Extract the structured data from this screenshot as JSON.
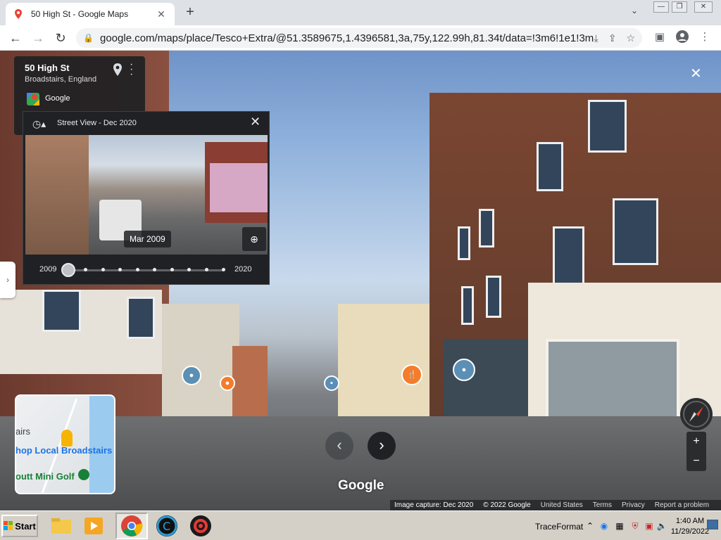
{
  "browser": {
    "tab_title": "50 High St - Google Maps",
    "tab_close": "✕",
    "new_tab": "+",
    "tab_menu": "⌄",
    "url": "google.com/maps/place/Tesco+Extra/@51.3589675,1.4396581,3a,75y,122.99h,81.34t/data=!3m6!1e1!3m...",
    "window_controls": [
      "—",
      "❐",
      "✕"
    ]
  },
  "place_card": {
    "address": "50 High St",
    "locality": "Broadstairs, England",
    "provider": "Google"
  },
  "timeline": {
    "header": "Street View - Dec 2020",
    "selected_date": "Mar 2009",
    "start_year": "2009",
    "end_year": "2020",
    "selected_fraction": 0.0,
    "stops": 10
  },
  "minimap": {
    "labels": [
      "airs",
      "hop Local Broadstairs",
      "outt Mini Golf"
    ]
  },
  "street_view": {
    "watermark": "Google"
  },
  "footer": {
    "capture": "Image capture: Dec 2020",
    "copyright": "© 2022 Google",
    "links": [
      "United States",
      "Terms",
      "Privacy",
      "Report a problem"
    ]
  },
  "zoom": {
    "in": "+",
    "out": "−"
  },
  "taskbar": {
    "start": "Start",
    "tray_app": "TraceFormat",
    "time": "1:40 AM",
    "date": "11/29/2022"
  },
  "colors": {
    "panel_bg": "#202124",
    "accent_blue": "#1a73e8",
    "poi_blue": "#5b8fb5",
    "poi_orange": "#f57c2a"
  }
}
